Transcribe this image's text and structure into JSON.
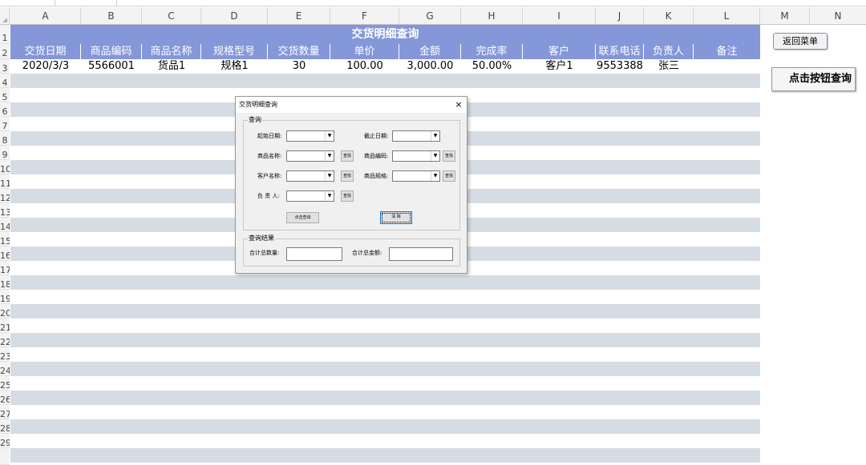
{
  "columns": [
    "A",
    "B",
    "C",
    "D",
    "E",
    "F",
    "G",
    "H",
    "I",
    "J",
    "K",
    "L",
    "M",
    "N"
  ],
  "rows": [
    "1",
    "2",
    "3",
    "4",
    "5",
    "6",
    "7",
    "8",
    "9",
    "10",
    "11",
    "12",
    "13",
    "14",
    "15",
    "16",
    "17",
    "18",
    "19",
    "20",
    "21",
    "22",
    "23",
    "24",
    "25",
    "26",
    "27",
    "28",
    "29"
  ],
  "sheet": {
    "title": "交货明细查询",
    "headers": [
      "交货日期",
      "商品编码",
      "商品名称",
      "规格型号",
      "交货数量",
      "单价",
      "金额",
      "完成率",
      "客户",
      "联系电话",
      "负责人",
      "备注"
    ],
    "data_row": [
      "2020/3/3",
      "5566001",
      "货品1",
      "规格1",
      "30",
      "100.00",
      "3,000.00",
      "50.00%",
      "客户1",
      "9553388",
      "张三",
      ""
    ]
  },
  "buttons": {
    "back": "返回菜单",
    "query": "点击按钮查询"
  },
  "dialog": {
    "title": "交货明细查询",
    "close": "×",
    "query_group": "查询",
    "start_date_label": "起始日期:",
    "end_date_label": "截止日期:",
    "product_name_label": "商品名称:",
    "product_code_label": "商品编码:",
    "customer_label": "客户名称:",
    "spec_label": "商品规格:",
    "manager_label": "负 责 人:",
    "find_button": "查找",
    "query_button": "点击查询",
    "clear_button": "清 除",
    "result_group": "查询结果",
    "total_qty_label": "合计总数量:",
    "total_amount_label": "合计总金额:"
  },
  "colors": {
    "header_blue": "#8497d8",
    "band_gray": "#d6dce4"
  }
}
